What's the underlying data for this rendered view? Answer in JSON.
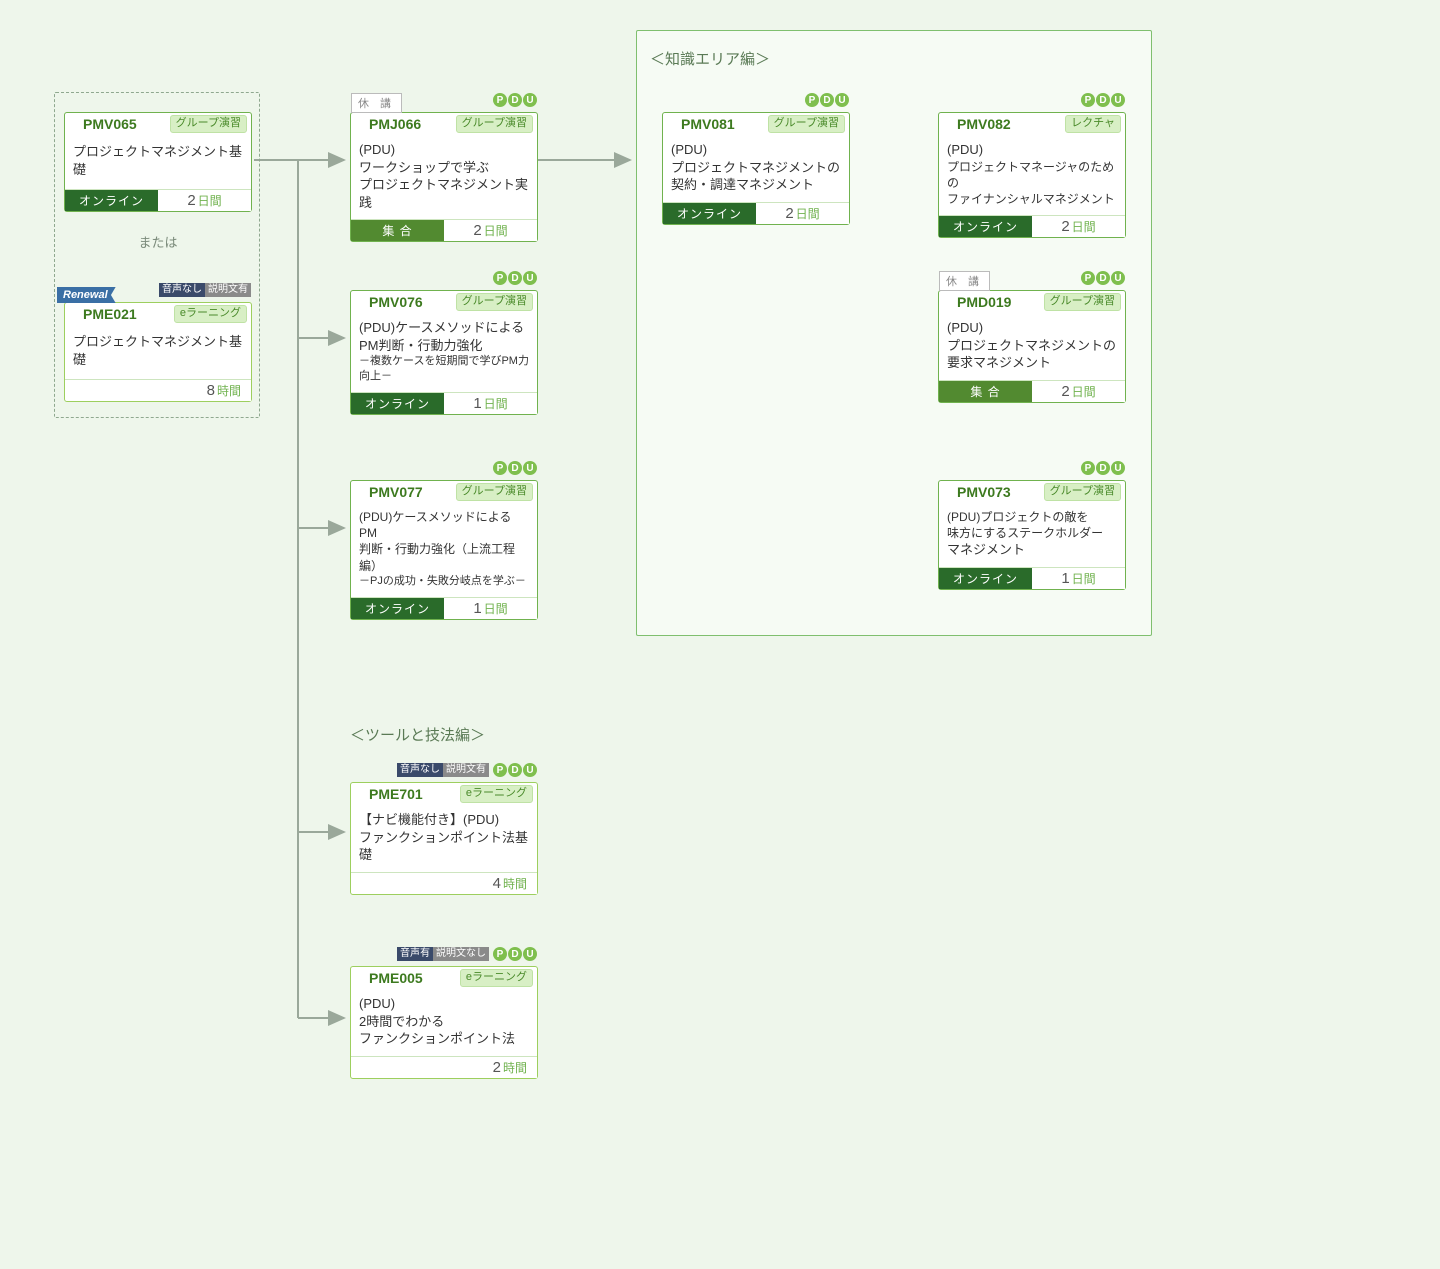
{
  "labels": {
    "or": "または",
    "section_knowledge": "＜知識エリア編＞",
    "section_tools": "＜ツールと技法編＞",
    "suspended": "休 講",
    "pdu_p": "P",
    "pdu_d": "D",
    "pdu_u": "U",
    "renewal": "Renewal",
    "type_group": "グループ演習",
    "type_lecture": "レクチャ",
    "type_elearning": "eラーニング",
    "mode_online": "オンライン",
    "mode_gather": "集 合",
    "unit_days": "日間",
    "unit_hours": "時間"
  },
  "audio": {
    "no_audio": "音声なし",
    "has_desc": "説明文有",
    "has_audio": "音声有",
    "no_desc": "説明文なし"
  },
  "cards": {
    "pmv065": {
      "code": "PMV065",
      "type": "グループ演習",
      "title": "プロジェクトマネジメント基礎",
      "mode": "オンライン",
      "dur": "2",
      "unit": "日間"
    },
    "pme021": {
      "code": "PME021",
      "type": "eラーニング",
      "title": "プロジェクトマネジメント基礎",
      "dur": "8",
      "unit": "時間"
    },
    "pmj066": {
      "code": "PMJ066",
      "type": "グループ演習",
      "title1": "(PDU)",
      "title2": "ワークショップで学ぶ",
      "title3": "プロジェクトマネジメント実践",
      "mode": "集 合",
      "dur": "2",
      "unit": "日間"
    },
    "pmv076": {
      "code": "PMV076",
      "type": "グループ演習",
      "title1": "(PDU)ケースメソッドによる",
      "title2": "PM判断・行動力強化",
      "title3": "－複数ケースを短期間で学びPM力向上－",
      "mode": "オンライン",
      "dur": "1",
      "unit": "日間"
    },
    "pmv077": {
      "code": "PMV077",
      "type": "グループ演習",
      "title1": "(PDU)ケースメソッドによるPM",
      "title2": "判断・行動力強化（上流工程編）",
      "title3": "－PJの成功・失敗分岐点を学ぶ－",
      "mode": "オンライン",
      "dur": "1",
      "unit": "日間"
    },
    "pme701": {
      "code": "PME701",
      "type": "eラーニング",
      "title1": "【ナビ機能付き】(PDU)",
      "title2": "ファンクションポイント法基礎",
      "dur": "4",
      "unit": "時間"
    },
    "pme005": {
      "code": "PME005",
      "type": "eラーニング",
      "title1": "(PDU)",
      "title2": "2時間でわかる",
      "title3": "ファンクションポイント法",
      "dur": "2",
      "unit": "時間"
    },
    "pmv081": {
      "code": "PMV081",
      "type": "グループ演習",
      "title1": "(PDU)",
      "title2": "プロジェクトマネジメントの",
      "title3": "契約・調達マネジメント",
      "mode": "オンライン",
      "dur": "2",
      "unit": "日間"
    },
    "pmv082": {
      "code": "PMV082",
      "type": "レクチャ",
      "title1": "(PDU)",
      "title2": "プロジェクトマネージャのための",
      "title3": "ファイナンシャルマネジメント",
      "mode": "オンライン",
      "dur": "2",
      "unit": "日間"
    },
    "pmd019": {
      "code": "PMD019",
      "type": "グループ演習",
      "title1": "(PDU)",
      "title2": "プロジェクトマネジメントの",
      "title3": "要求マネジメント",
      "mode": "集 合",
      "dur": "2",
      "unit": "日間"
    },
    "pmv073": {
      "code": "PMV073",
      "type": "グループ演習",
      "title1": "(PDU)プロジェクトの敵を",
      "title2": "味方にするステークホルダー",
      "title3": "マネジメント",
      "mode": "オンライン",
      "dur": "1",
      "unit": "日間"
    }
  }
}
